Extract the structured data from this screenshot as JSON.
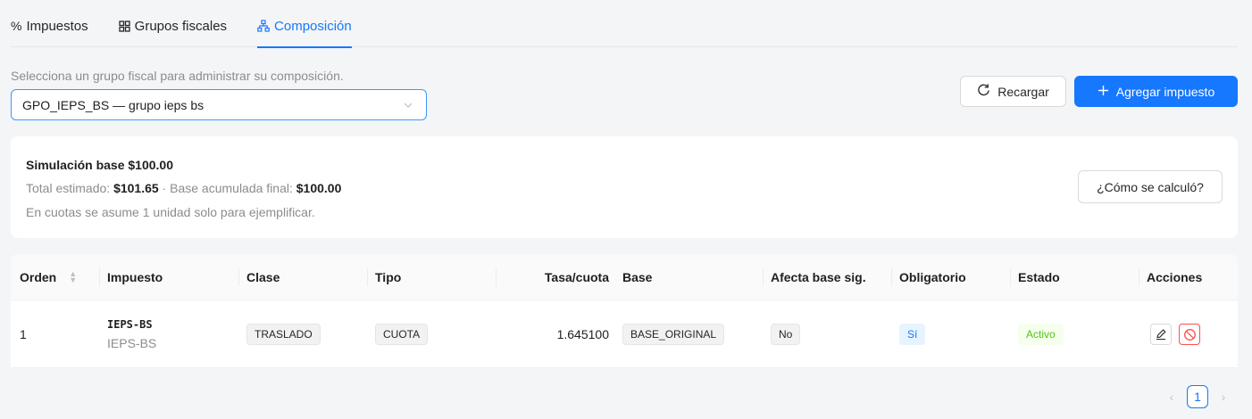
{
  "tabs": [
    {
      "icon": "%",
      "label": "Impuestos"
    },
    {
      "icon": "grid",
      "label": "Grupos fiscales"
    },
    {
      "icon": "hierarchy",
      "label": "Composición"
    }
  ],
  "active_tab": 2,
  "hint": "Selecciona un grupo fiscal para administrar su composición.",
  "group_select": {
    "value": "GPO_IEPS_BS — grupo ieps bs"
  },
  "toolbar": {
    "reload_label": "Recargar",
    "add_label": "Agregar impuesto"
  },
  "simulation": {
    "title": "Simulación base $100.00",
    "total_label": "Total estimado: ",
    "total_value": "$101.65",
    "separator": " · ",
    "base_label": "Base acumulada final: ",
    "base_value": "$100.00",
    "note": "En cuotas se asume 1 unidad solo para ejemplificar.",
    "how_label": "¿Cómo se calculó?"
  },
  "table": {
    "headers": {
      "orden": "Orden",
      "impuesto": "Impuesto",
      "clase": "Clase",
      "tipo": "Tipo",
      "tasa": "Tasa/cuota",
      "base": "Base",
      "afecta": "Afecta base sig.",
      "obligatorio": "Obligatorio",
      "estado": "Estado",
      "acciones": "Acciones"
    },
    "rows": [
      {
        "orden": "1",
        "impuesto_code": "IEPS-BS",
        "impuesto_name": "IEPS-BS",
        "clase": "TRASLADO",
        "tipo": "CUOTA",
        "tasa": "1.645100",
        "base": "BASE_ORIGINAL",
        "afecta": "No",
        "obligatorio": "Sí",
        "estado": "Activo"
      }
    ]
  },
  "pagination": {
    "current": "1"
  },
  "colors": {
    "primary": "#1677ff",
    "danger": "#ff4d4f",
    "success": "#52c41a"
  }
}
